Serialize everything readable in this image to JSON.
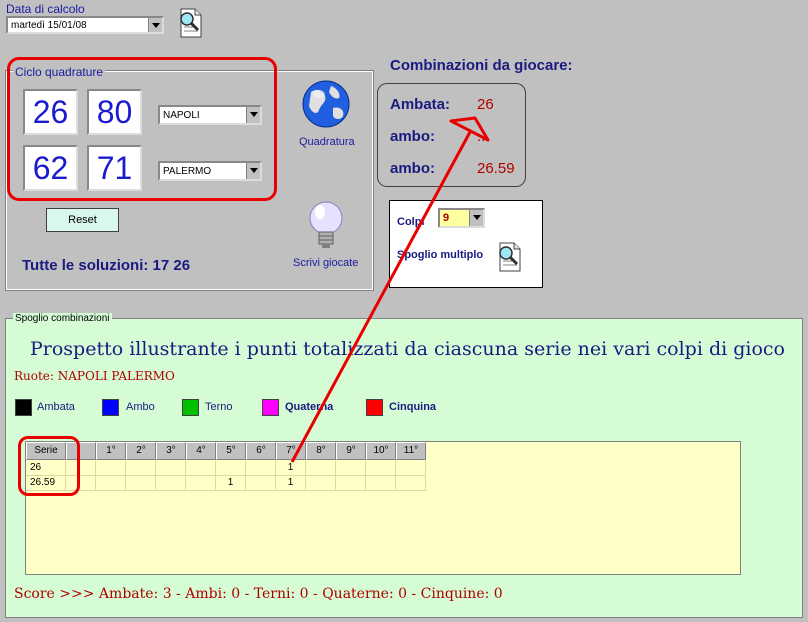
{
  "date": {
    "label": "Data di calcolo",
    "value": "martedì 15/01/08"
  },
  "ciclo": {
    "legend": "Ciclo quadrature",
    "row1": {
      "a": "26",
      "b": "80",
      "wheel": "NAPOLI"
    },
    "row2": {
      "a": "62",
      "b": "71",
      "wheel": "PALERMO"
    },
    "quadratura_label": "Quadratura",
    "reset_label": "Reset",
    "solutions": "Tutte le soluzioni: 17 26",
    "scrivi_label": "Scrivi giocate"
  },
  "combinazioni": {
    "title": "Combinazioni da giocare:",
    "items": [
      {
        "label": "Ambata:",
        "value": "26"
      },
      {
        "label": "ambo:",
        "value": ".."
      },
      {
        "label": "ambo:",
        "value": "26.59"
      }
    ]
  },
  "colpi": {
    "label": "Colpi",
    "value": "9",
    "spoglio_label": "Spoglio multiplo"
  },
  "spoglio": {
    "legend": "Spoglio combinazioni",
    "title": "Prospetto illustrante i punti totalizzati da ciascuna serie nei vari colpi di gioco",
    "ruote": "Ruote: NAPOLI PALERMO",
    "legend_items": [
      {
        "label": "Ambata",
        "color": "#000000",
        "bold": false
      },
      {
        "label": "Ambo",
        "color": "#0000ff",
        "bold": false
      },
      {
        "label": "Terno",
        "color": "#00c000",
        "bold": false
      },
      {
        "label": "Quaterna",
        "color": "#ff00ff",
        "bold": true
      },
      {
        "label": "Cinquina",
        "color": "#ff0000",
        "bold": true
      }
    ],
    "table": {
      "headers": [
        "Serie",
        "",
        "1°",
        "2°",
        "3°",
        "4°",
        "5°",
        "6°",
        "7°",
        "8°",
        "9°",
        "10°",
        "11°"
      ],
      "rows": [
        [
          "26",
          "",
          "",
          "",
          "",
          "",
          "",
          "",
          "1",
          "",
          "",
          "",
          ""
        ],
        [
          "26.59",
          "",
          "",
          "",
          "",
          "",
          "1",
          "",
          "1",
          "",
          "",
          "",
          ""
        ]
      ]
    },
    "score": "Score >>> Ambate: 3 - Ambi: 0 - Terni: 0 - Quaterne: 0 - Cinquine: 0"
  }
}
